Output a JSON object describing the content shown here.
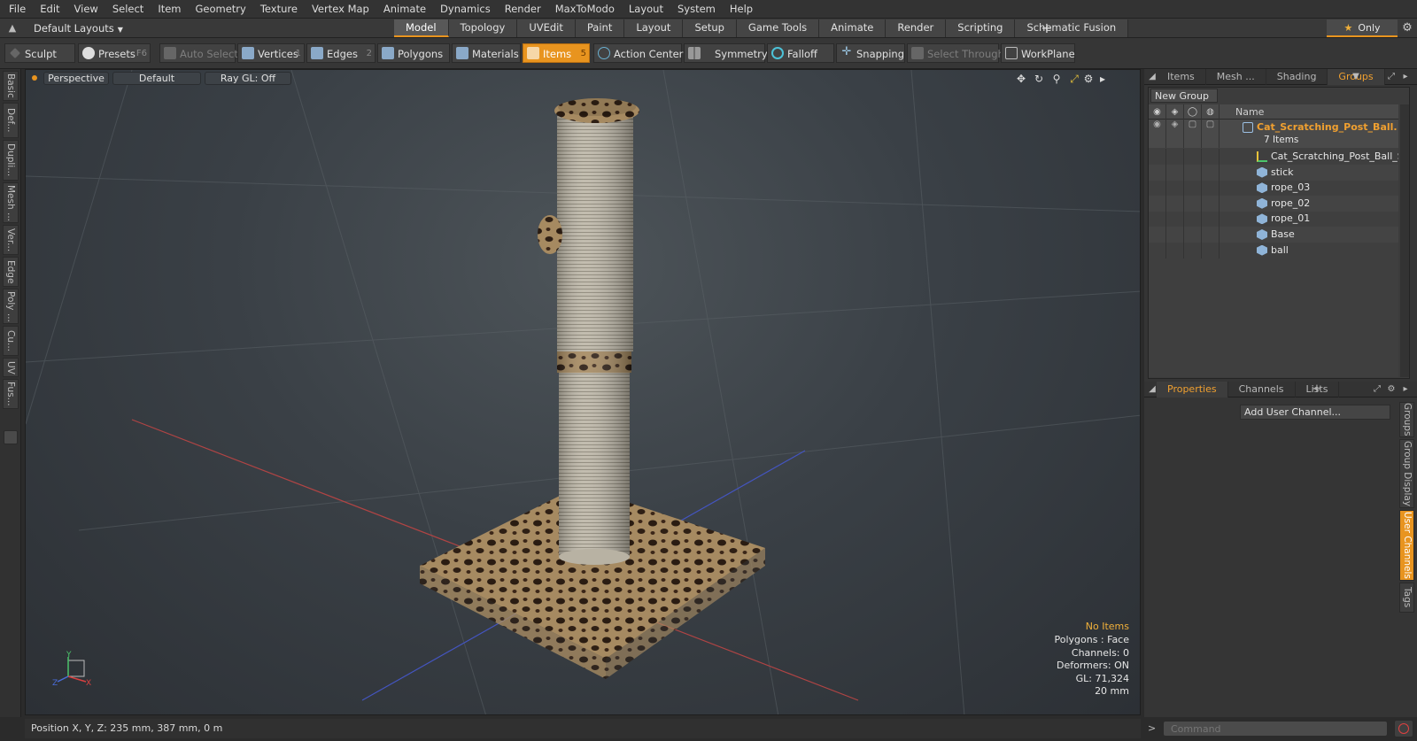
{
  "menubar": [
    "File",
    "Edit",
    "View",
    "Select",
    "Item",
    "Geometry",
    "Texture",
    "Vertex Map",
    "Animate",
    "Dynamics",
    "Render",
    "MaxToModo",
    "Layout",
    "System",
    "Help"
  ],
  "layoutbar": {
    "dropdown": "Default Layouts",
    "tabs": [
      "Model",
      "Topology",
      "UVEdit",
      "Paint",
      "Layout",
      "Setup",
      "Game Tools",
      "Animate",
      "Render",
      "Scripting",
      "Schematic Fusion"
    ],
    "active_tab": "Model",
    "only_label": "Only"
  },
  "toolbar": {
    "sculpt": "Sculpt",
    "presets": "Presets",
    "presets_key": "F6",
    "auto_select": "Auto Select",
    "vertices": "Vertices",
    "vertices_key": "1",
    "edges": "Edges",
    "edges_key": "2",
    "polygons": "Polygons",
    "materials": "Materials",
    "items": "Items",
    "items_key": "5",
    "action_center": "Action Center",
    "symmetry": "Symmetry",
    "falloff": "Falloff",
    "snapping": "Snapping",
    "select_through": "Select Through",
    "workplane": "WorkPlane"
  },
  "left_tabs": [
    "Basic",
    "Def...",
    "Dupli...",
    "Mesh ...",
    "Ver...",
    "Edge",
    "Poly ...",
    "Cu...",
    "UV",
    "Fus..."
  ],
  "viewport": {
    "view": "Perspective",
    "shading": "Default",
    "raygl": "Ray GL: Off",
    "info": {
      "selection": "No Items",
      "polygons": "Polygons : Face",
      "channels": "Channels: 0",
      "deformers": "Deformers: ON",
      "gl": "GL: 71,324",
      "scale": "20 mm"
    },
    "axis": {
      "y": "Y",
      "z": "Z",
      "x": "X"
    },
    "colors": {
      "bg": "#3f454a",
      "fur": "#a58a62",
      "rope": "#b8b2a4",
      "accent": "#e8941f"
    }
  },
  "right_panel": {
    "tabs": [
      "Items",
      "Mesh ...",
      "Shading",
      "Groups"
    ],
    "active_tab": "Groups",
    "new_group": "New Group",
    "name_header": "Name",
    "groups": {
      "root_name": "Cat_Scratching_Post_Ball...",
      "root_count": "7 Items",
      "children": [
        "Cat_Scratching_Post_Ball_S...",
        "stick",
        "rope_03",
        "rope_02",
        "rope_01",
        "Base",
        "ball"
      ]
    },
    "lower_tabs": [
      "Properties",
      "Channels",
      "Lists"
    ],
    "active_lower": "Properties",
    "add_user_channel": "Add User Channel...",
    "vtabs": [
      "Groups",
      "Group Display",
      "User Channels",
      "Tags"
    ],
    "active_vtab": "User Channels"
  },
  "command": {
    "prompt": ">",
    "placeholder": "Command"
  },
  "statusbar": {
    "position": "Position X, Y, Z:  235 mm, 387 mm, 0 m"
  }
}
